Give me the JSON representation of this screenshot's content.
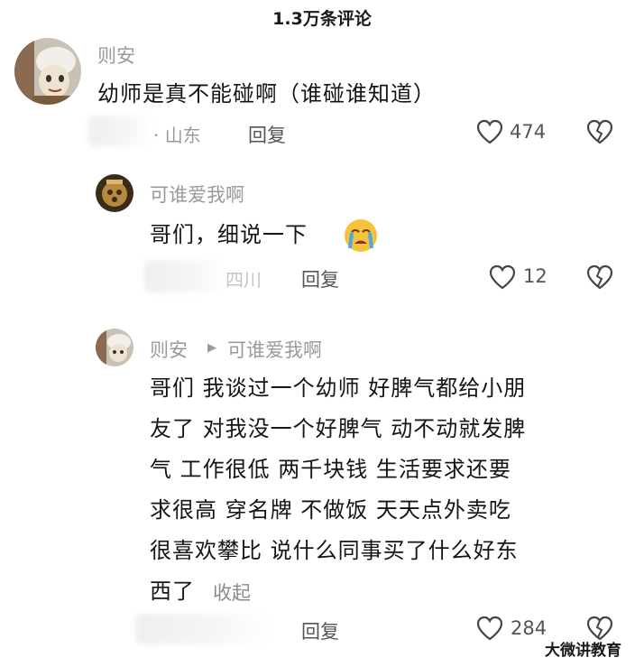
{
  "header": {
    "title": "1.3万条评论"
  },
  "comments": [
    {
      "author": "则安",
      "text": "幼师是真不能碰啊（谁碰谁知道）",
      "location": "· 山东",
      "reply_label": "回复",
      "likes": "474"
    },
    {
      "author": "可谁爱我啊",
      "text": "哥们，细说一下",
      "location": "四川",
      "reply_label": "回复",
      "likes": "12",
      "emoji": "crying-face"
    },
    {
      "author": "则安",
      "reply_to": "可谁爱我啊",
      "lines": [
        "哥们 我谈过一个幼师 好脾气都给小朋",
        "友了 对我没一个好脾气 动不动就发脾",
        "气 工作很低 两千块钱 生活要求还要",
        "求很高 穿名牌 不做饭 天天点外卖吃",
        "很喜欢攀比 说什么同事买了什么好东",
        "西了"
      ],
      "collapse_label": "收起",
      "reply_label": "回复",
      "likes": "284"
    }
  ],
  "watermark": "大微讲教育",
  "colors": {
    "meta": "#9a9a9a",
    "text": "#151515",
    "background": "#ffffff"
  }
}
